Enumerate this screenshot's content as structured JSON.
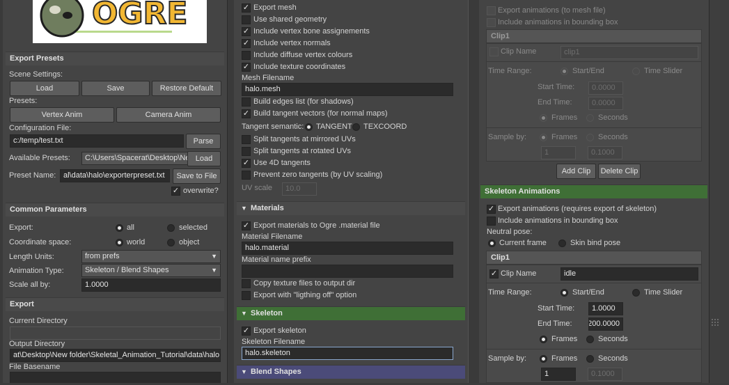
{
  "logo": {
    "text": "OGRE"
  },
  "export_presets": {
    "header": "Export Presets",
    "scene_settings_label": "Scene Settings:",
    "load_label": "Load",
    "save_label": "Save",
    "restore_default_label": "Restore Default",
    "presets_label": "Presets:",
    "vertex_anim_label": "Vertex Anim",
    "camera_anim_label": "Camera Anim",
    "config_file_label": "Configuration File:",
    "config_file_value": "c:/temp/test.txt",
    "parse_label": "Parse",
    "available_presets_label": "Available Presets:",
    "available_presets_value": "C:\\Users\\Spacerat\\Desktop\\Ne",
    "available_load_label": "Load",
    "preset_name_label": "Preset Name:",
    "preset_name_value": "al\\data\\halo\\exporterpreset.txt",
    "save_to_file_label": "Save to File",
    "overwrite_label": "overwrite?"
  },
  "common": {
    "header": "Common Parameters",
    "export_label": "Export:",
    "export_all": "all",
    "export_selected": "selected",
    "coord_label": "Coordinate space:",
    "coord_world": "world",
    "coord_object": "object",
    "length_units_label": "Length Units:",
    "length_units_value": "from prefs",
    "anim_type_label": "Animation Type:",
    "anim_type_value": "Skeleton / Blend Shapes",
    "scale_label": "Scale all by:",
    "scale_value": "1.0000"
  },
  "export": {
    "header": "Export",
    "current_dir_label": "Current Directory",
    "current_dir_value": "",
    "output_dir_label": "Output Directory",
    "output_dir_value": "at\\Desktop\\New folder\\Skeletal_Animation_Tutorial\\data\\halo",
    "file_basename_label": "File Basename"
  },
  "mesh": {
    "export_mesh": "Export mesh",
    "shared_geometry": "Use shared geometry",
    "bone_assign": "Include vertex bone assignements",
    "normals": "Include vertex normals",
    "diffuse": "Include diffuse vertex colours",
    "texcoords": "Include texture coordinates",
    "filename_label": "Mesh Filename",
    "filename_value": "halo.mesh",
    "edges": "Build edges list (for shadows)",
    "tangents": "Build tangent vectors (for normal maps)",
    "tangent_semantic_label": "Tangent semantic:",
    "tangent_opt": "TANGENT",
    "texcoord_opt": "TEXCOORD",
    "split_mirrored": "Split tangents at mirrored UVs",
    "split_rotated": "Split tangents at rotated UVs",
    "use_4d": "Use 4D tangents",
    "prevent_zero": "Prevent zero tangents (by UV scaling)",
    "uv_scale_label": "UV scale",
    "uv_scale_value": "10.0"
  },
  "materials": {
    "header": "Materials",
    "export_materials": "Export materials to Ogre .material file",
    "filename_label": "Material Filename",
    "filename_value": "halo.material",
    "prefix_label": "Material name prefix",
    "prefix_value": "",
    "copy_textures": "Copy texture files to output dir",
    "lighting_off": "Export with \"ligthing off\" option"
  },
  "skeleton": {
    "header": "Skeleton",
    "export_skeleton": "Export skeleton",
    "filename_label": "Skeleton Filename",
    "filename_value": "halo.skeleton"
  },
  "blend_shapes": {
    "header": "Blend Shapes"
  },
  "blend_anims": {
    "export_anims": "Export animations (to mesh file)",
    "include_bbox": "Include animations in bounding box",
    "clip_header": "Clip1",
    "clip_name_label": "Clip Name",
    "clip_name_value": "clip1",
    "time_range_label": "Time Range:",
    "start_end": "Start/End",
    "time_slider": "Time Slider",
    "start_time_label": "Start Time:",
    "start_time_value": "0.0000",
    "end_time_label": "End Time:",
    "end_time_value": "0.0000",
    "frames": "Frames",
    "seconds": "Seconds",
    "sample_by_label": "Sample by:",
    "sample_frames_value": "1",
    "sample_seconds_value": "0.1000",
    "add_clip_label": "Add Clip",
    "delete_clip_label": "Delete Clip"
  },
  "skeleton_anims": {
    "header": "Skeleton Animations",
    "export_anims": "Export animations (requires export of skeleton)",
    "include_bbox": "Include animations in bounding box",
    "neutral_pose_label": "Neutral pose:",
    "current_frame": "Current frame",
    "skin_bind_pose": "Skin bind pose",
    "clip_header": "Clip1",
    "clip_name_label": "Clip Name",
    "clip_name_value": "idle",
    "time_range_label": "Time Range:",
    "start_end": "Start/End",
    "time_slider": "Time Slider",
    "start_time_label": "Start Time:",
    "start_time_value": "1.0000",
    "end_time_label": "End Time:",
    "end_time_value": "200.0000",
    "frames": "Frames",
    "seconds": "Seconds",
    "sample_by_label": "Sample by:",
    "sample_frames_value": "1",
    "sample_seconds_value": "0.1000"
  }
}
